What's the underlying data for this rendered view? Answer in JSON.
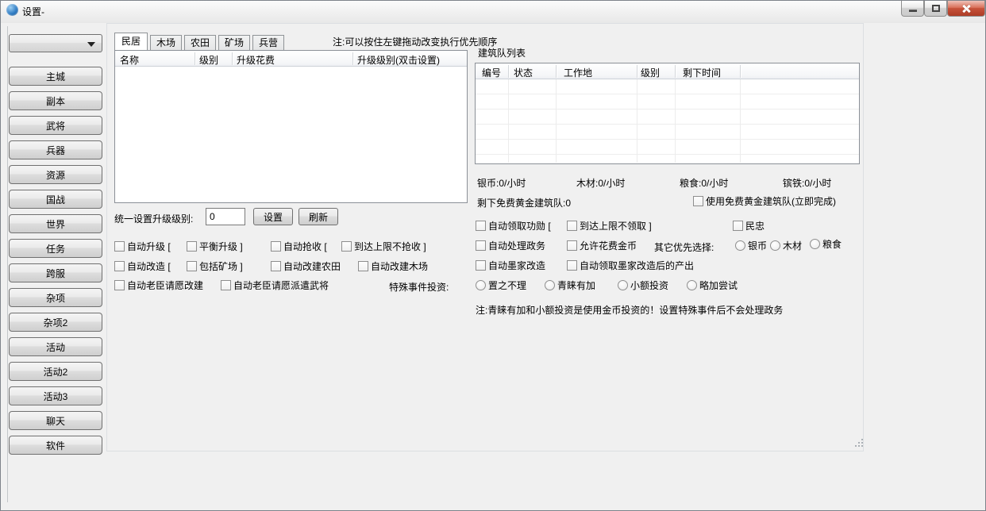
{
  "window": {
    "title": "设置-"
  },
  "icons": {
    "app_icon": "blue-globe",
    "minimize_icon": "horizontal-bar",
    "maximize_icon": "square-outline",
    "close_icon": "cross",
    "combo_arrow_icon": "filled-down-triangle",
    "resize_grip_icon": "diagonal-dots"
  },
  "sidebar": {
    "dropdown_value": "",
    "items": [
      "主城",
      "副本",
      "武将",
      "兵器",
      "资源",
      "国战",
      "世界",
      "任务",
      "跨服",
      "杂项",
      "杂项2",
      "活动",
      "活动2",
      "活动3",
      "聊天",
      "软件"
    ]
  },
  "tabs": {
    "active": "民居",
    "items": [
      "民居",
      "木场",
      "农田",
      "矿场",
      "兵营"
    ]
  },
  "note_top": "注:可以按住左键拖动改变执行优先顺序",
  "building_table": {
    "columns": [
      "名称",
      "级别",
      "升级花费",
      "升级级别(双击设置)"
    ],
    "rows": []
  },
  "level_setter": {
    "label": "统一设置升级级别:",
    "value": "0",
    "set_button": "设置",
    "refresh_button": "刷新"
  },
  "options_left": {
    "row1": [
      "自动升级 [",
      "平衡升级 ]",
      "自动抢收 [",
      "到达上限不抢收 ]"
    ],
    "row2": [
      "自动改造 [",
      "包括矿场 ]",
      "自动改建农田",
      "自动改建木场"
    ],
    "row3": [
      "自动老臣请愿改建",
      "自动老臣请愿派遣武将"
    ]
  },
  "queue_panel": {
    "title": "建筑队列表",
    "columns": [
      "编号",
      "状态",
      "工作地",
      "级别",
      "剩下时间"
    ],
    "rows": []
  },
  "rates": [
    "银币:0/小时",
    "木材:0/小时",
    "粮食:0/小时",
    "镔铁:0/小时"
  ],
  "free_queue": {
    "remaining": "剩下免费黄金建筑队:0",
    "use_checkbox": "使用免费黄金建筑队(立即完成)"
  },
  "options_right": {
    "row1": [
      "自动领取功勋 [",
      "到达上限不领取 ]",
      "民忠"
    ],
    "row2": [
      "自动处理政务",
      "允许花费金币"
    ],
    "priority_label": "其它优先选择:",
    "priority_options": [
      "银币",
      "木材",
      "粮食"
    ],
    "row3": [
      "自动墨家改造",
      "自动领取墨家改造后的产出"
    ]
  },
  "special_event": {
    "label": "特殊事件投资:",
    "options": [
      "置之不理",
      "青睐有加",
      "小额投资",
      "略加尝试"
    ]
  },
  "note_bottom": "注:青睐有加和小额投资是使用金币投资的！设置特殊事件后不会处理政务",
  "colors": {
    "close_button": "#c6523a",
    "window_bg": "#f0f0f0",
    "table_border": "#8b9097"
  }
}
